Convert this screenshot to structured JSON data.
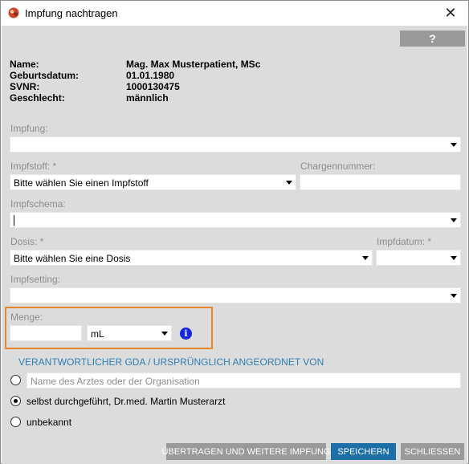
{
  "window": {
    "title": "Impfung nachtragen",
    "close_icon": "close-icon",
    "app_icon": "app-logo-icon"
  },
  "help": {
    "label": "?"
  },
  "patient": {
    "name_label": "Name:",
    "name_value": "Mag. Max Musterpatient, MSc",
    "birthdate_label": "Geburtsdatum:",
    "birthdate_value": "01.01.1980",
    "svnr_label": "SVNR:",
    "svnr_value": "1000130475",
    "gender_label": "Geschlecht:",
    "gender_value": "männlich"
  },
  "form": {
    "impfung_label": "Impfung:",
    "impfung_value": "",
    "impfstoff_label": "Impfstoff: *",
    "impfstoff_value": "Bitte wählen Sie einen Impfstoff",
    "charge_label": "Chargennummer:",
    "charge_value": "",
    "impfschema_label": "Impfschema:",
    "impfschema_value": "",
    "dosis_label": "Dosis: *",
    "dosis_value": "Bitte wählen Sie eine Dosis",
    "impfdatum_label": "Impfdatum: *",
    "impfdatum_value": "",
    "impfsetting_label": "Impfsetting:",
    "impfsetting_value": "",
    "menge_label": "Menge:",
    "menge_value": "",
    "unit_value": "mL",
    "info_icon": "info-icon"
  },
  "gda": {
    "section_title": "VERANTWORTLICHER GDA / URSPRÜNGLICH ANGEORDNET VON",
    "options": [
      {
        "label": "",
        "placeholder": "Name des Arztes oder der Organisation",
        "checked": false
      },
      {
        "label": "selbst durchgeführt, Dr.med. Martin Musterarzt",
        "checked": true
      },
      {
        "label": "unbekannt",
        "checked": false
      }
    ]
  },
  "buttons": {
    "transfer_label": "ÜBERTRAGEN UND WEITERE IMPFUNG",
    "save_label": "SPEICHERN",
    "close_label": "SCHLIESSEN"
  },
  "colors": {
    "accent_blue": "#1d6fa8",
    "section_blue": "#2e7db3",
    "highlight_orange": "#e8862e",
    "panel_grey": "#dcdcdc",
    "button_grey": "#9a9a9a"
  }
}
